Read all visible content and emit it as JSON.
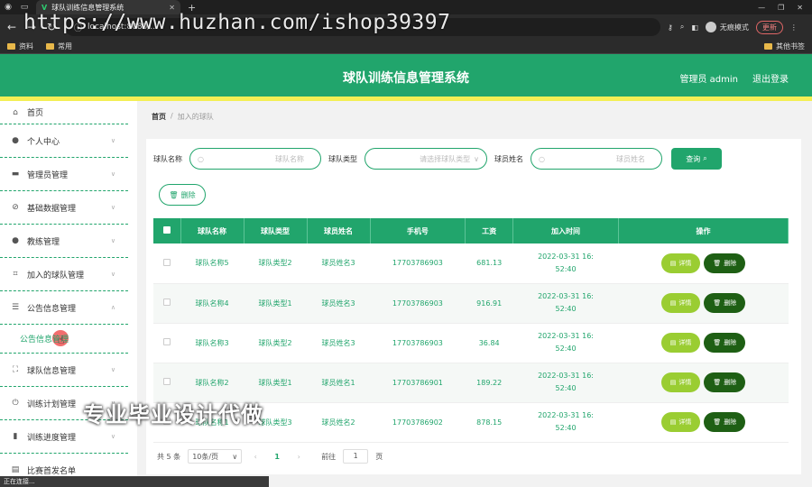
{
  "browser": {
    "tab_title": "球队训练信息管理系统",
    "url": "localhost:8080/...",
    "incognito": "无痕模式",
    "update": "更新",
    "bookmarks": [
      "资料",
      "常用"
    ],
    "other_bookmarks": "其他书签",
    "watermark": "https://www.huzhan.com/ishop39397",
    "status": "正在连接..."
  },
  "header": {
    "title": "球队训练信息管理系统",
    "user": "管理员 admin",
    "logout": "退出登录"
  },
  "sidebar": {
    "items": [
      {
        "label": "首页",
        "icon": "home-icon"
      },
      {
        "label": "个人中心",
        "icon": "user-icon"
      },
      {
        "label": "管理员管理",
        "icon": "briefcase-icon"
      },
      {
        "label": "基础数据管理",
        "icon": "data-icon"
      },
      {
        "label": "教练管理",
        "icon": "coach-icon"
      },
      {
        "label": "加入的球队管理",
        "icon": "team-icon"
      },
      {
        "label": "公告信息管理",
        "icon": "notice-icon"
      },
      {
        "label": "球队信息管理",
        "icon": "frame-icon"
      },
      {
        "label": "训练计划管理",
        "icon": "power-icon"
      },
      {
        "label": "训练进度管理",
        "icon": "chart-icon"
      },
      {
        "label": "比赛首发名单",
        "icon": "list-icon"
      }
    ],
    "sub_item": "公告信息管理"
  },
  "breadcrumb": {
    "home": "首页",
    "sep": "/",
    "current": "加入的球队"
  },
  "search": {
    "team_name_label": "球队名称",
    "team_name_placeholder": "球队名称",
    "team_type_label": "球队类型",
    "team_type_placeholder": "请选择球队类型",
    "player_name_label": "球员姓名",
    "player_name_placeholder": "球员姓名",
    "query_button": "查询",
    "batch_delete": "删除"
  },
  "table": {
    "headers": [
      "球队名称",
      "球队类型",
      "球员姓名",
      "手机号",
      "工资",
      "加入时间",
      "操作"
    ],
    "rows": [
      {
        "team": "球队名称5",
        "type": "球队类型2",
        "player": "球员姓名3",
        "phone": "17703786903",
        "salary": "681.13",
        "time1": "2022-03-31 16:",
        "time2": "52:40"
      },
      {
        "team": "球队名称4",
        "type": "球队类型1",
        "player": "球员姓名3",
        "phone": "17703786903",
        "salary": "916.91",
        "time1": "2022-03-31 16:",
        "time2": "52:40"
      },
      {
        "team": "球队名称3",
        "type": "球队类型2",
        "player": "球员姓名3",
        "phone": "17703786903",
        "salary": "36.84",
        "time1": "2022-03-31 16:",
        "time2": "52:40"
      },
      {
        "team": "球队名称2",
        "type": "球队类型1",
        "player": "球员姓名1",
        "phone": "17703786901",
        "salary": "189.22",
        "time1": "2022-03-31 16:",
        "time2": "52:40"
      },
      {
        "team": "球队名称1",
        "type": "球队类型3",
        "player": "球员姓名2",
        "phone": "17703786902",
        "salary": "878.15",
        "time1": "2022-03-31 16:",
        "time2": "52:40"
      }
    ],
    "detail_label": "详情",
    "delete_label": "删除"
  },
  "pager": {
    "total": "共 5 条",
    "page_size": "10条/页",
    "current": "1",
    "goto_label": "前往",
    "goto_value": "1",
    "page_suffix": "页"
  },
  "overlay": "专业毕业设计代做",
  "colors": {
    "primary": "#21a56c",
    "accent": "#f3ef55",
    "detail": "#9acd32",
    "delete": "#1e5f14"
  }
}
